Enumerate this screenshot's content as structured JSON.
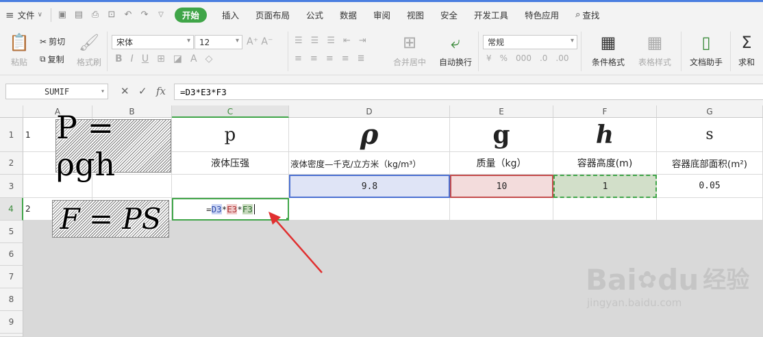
{
  "menu": {
    "file": "文件",
    "tabs": [
      "开始",
      "插入",
      "页面布局",
      "公式",
      "数据",
      "审阅",
      "视图",
      "安全",
      "开发工具",
      "特色应用"
    ],
    "active_tab": "开始",
    "search": "查找",
    "accent": "#3fa548"
  },
  "ribbon": {
    "paste": "粘贴",
    "cut": "剪切",
    "copy": "复制",
    "format_painter": "格式刷",
    "font_name": "宋体",
    "font_size": "12",
    "merge": "合并居中",
    "wrap": "自动换行",
    "number_format": "常规",
    "cond_format": "条件格式",
    "table_style": "表格样式",
    "doc_helper": "文档助手",
    "sum": "求和"
  },
  "formula_bar": {
    "name_box": "SUMIF",
    "fx": "fx",
    "formula": "=D3*E3*F3"
  },
  "columns": [
    "A",
    "B",
    "C",
    "D",
    "E",
    "F",
    "G"
  ],
  "rows": [
    "1",
    "2",
    "3",
    "4",
    "5",
    "6",
    "7",
    "8",
    "9"
  ],
  "cells": {
    "A1": "1",
    "A4": "2",
    "C1": "p",
    "D1": "ρ",
    "E1": "g",
    "F1": "h",
    "G1": "s",
    "C2": "液体压强",
    "D2": "液体密度—千克/立方米（kg/m³）",
    "E2": "质量（kg）",
    "F2": "容器高度(m)",
    "G2": "容器底部面积(m²)",
    "D3": "9.8",
    "E3": "10",
    "F3": "1",
    "G3": "0.05"
  },
  "edit_formula": {
    "eq": "=",
    "ref1": "D3",
    "op1": "*",
    "ref2": "E3",
    "op2": "*",
    "ref3": "F3"
  },
  "images": {
    "formula1": "P = ρgh",
    "formula2": "F = PS"
  },
  "watermark": {
    "brand": "Bai",
    "brand2": "du",
    "cn": "经验",
    "url": "jingyan.baidu.com"
  }
}
